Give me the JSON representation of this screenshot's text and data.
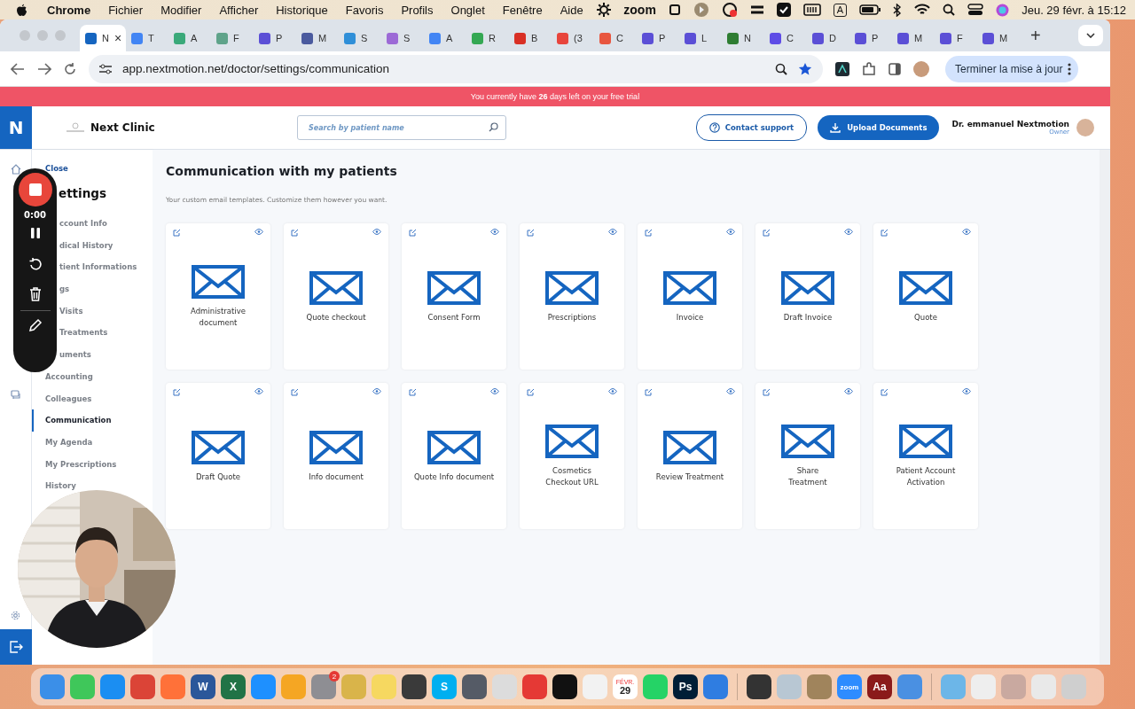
{
  "menubar": {
    "app": "Chrome",
    "menus": [
      "Fichier",
      "Modifier",
      "Afficher",
      "Historique",
      "Favoris",
      "Profils",
      "Onglet",
      "Fenêtre",
      "Aide"
    ],
    "zoom_label": "zoom",
    "input_source": "A",
    "clock": "Jeu. 29 févr. à 15:12"
  },
  "tab_close": "×",
  "new_tab": "+",
  "tabs": [
    {
      "label": "N",
      "selected": true,
      "color": "#1565c0"
    },
    {
      "label": "T",
      "selected": false,
      "color": "#4285f4"
    },
    {
      "label": "A",
      "selected": false,
      "color": "#3aa97a"
    },
    {
      "label": "F",
      "selected": false,
      "color": "#5fa38a"
    },
    {
      "label": "P",
      "selected": false,
      "color": "#5b4fd6"
    },
    {
      "label": "M",
      "selected": false,
      "color": "#4a5a9e"
    },
    {
      "label": "S",
      "selected": false,
      "color": "#2f8fd8"
    },
    {
      "label": "S",
      "selected": false,
      "color": "#9c6ad6"
    },
    {
      "label": "A",
      "selected": false,
      "color": "#4285f4"
    },
    {
      "label": "R",
      "selected": false,
      "color": "#34a853"
    },
    {
      "label": "B",
      "selected": false,
      "color": "#d93025"
    },
    {
      "label": "(3",
      "selected": false,
      "color": "#e8453c"
    },
    {
      "label": "C",
      "selected": false,
      "color": "#e8563f"
    },
    {
      "label": "P",
      "selected": false,
      "color": "#5b4fd6"
    },
    {
      "label": "L",
      "selected": false,
      "color": "#5b4fd6"
    },
    {
      "label": "N",
      "selected": false,
      "color": "#2e7d32"
    },
    {
      "label": "C",
      "selected": false,
      "color": "#5e4ce6"
    },
    {
      "label": "D",
      "selected": false,
      "color": "#5b4fd6"
    },
    {
      "label": "P",
      "selected": false,
      "color": "#5b4fd6"
    },
    {
      "label": "M",
      "selected": false,
      "color": "#5b4fd6"
    },
    {
      "label": "F",
      "selected": false,
      "color": "#5b4fd6"
    },
    {
      "label": "M",
      "selected": false,
      "color": "#5b4fd6"
    }
  ],
  "toolbar": {
    "url": "app.nextmotion.net/doctor/settings/communication",
    "update_button": "Terminer la mise à jour"
  },
  "banner": {
    "text": "You currently have **26** days left on your free trial"
  },
  "header": {
    "logo": "N",
    "clinic": "Next Clinic",
    "search_placeholder": "Search by patient name",
    "contact": "Contact support",
    "upload": "Upload Documents",
    "user": "Dr. emmanuel Nextmotion",
    "role": "Owner"
  },
  "sidebar": {
    "close": "Close",
    "title": "ettings",
    "items": [
      {
        "label": "ccount Info",
        "selected": false
      },
      {
        "label": "dical History",
        "selected": false
      },
      {
        "label": "tient Informations",
        "selected": false
      },
      {
        "label": "gs",
        "selected": false
      },
      {
        "label": "Visits",
        "selected": false
      },
      {
        "label": "Treatments",
        "selected": false
      },
      {
        "label": "uments",
        "selected": false
      },
      {
        "label": "Accounting",
        "selected": false
      },
      {
        "label": "Colleagues",
        "selected": false
      },
      {
        "label": "Communication",
        "selected": true
      },
      {
        "label": "My Agenda",
        "selected": false
      },
      {
        "label": "My Prescriptions",
        "selected": false
      },
      {
        "label": "History",
        "selected": false
      }
    ]
  },
  "content": {
    "title": "Communication with my patients",
    "subtitle": "Your custom email templates. Customize them however you want.",
    "templates": [
      {
        "label": "Administrative\ndocument"
      },
      {
        "label": "Quote checkout"
      },
      {
        "label": "Consent Form"
      },
      {
        "label": "Prescriptions"
      },
      {
        "label": "Invoice"
      },
      {
        "label": "Draft Invoice"
      },
      {
        "label": "Quote"
      },
      {
        "label": "Draft Quote"
      },
      {
        "label": "Info document"
      },
      {
        "label": "Quote Info document"
      },
      {
        "label": "Cosmetics\nCheckout URL"
      },
      {
        "label": "Review Treatment"
      },
      {
        "label": "Share\nTreatment"
      },
      {
        "label": "Patient Account\nActivation"
      }
    ]
  },
  "recorder": {
    "time": "0:00"
  },
  "dock": [
    {
      "kind": "app",
      "color": "#3b8fe8"
    },
    {
      "kind": "app",
      "color": "#3fc75a"
    },
    {
      "kind": "app",
      "color": "#1b8ef2"
    },
    {
      "kind": "app",
      "color": "#db4437"
    },
    {
      "kind": "app",
      "color": "#ff7139"
    },
    {
      "kind": "app",
      "color": "#2b579a",
      "label": "W"
    },
    {
      "kind": "app",
      "color": "#217346",
      "label": "X"
    },
    {
      "kind": "app",
      "color": "#1e90ff"
    },
    {
      "kind": "app",
      "color": "#f5a623"
    },
    {
      "kind": "app",
      "color": "#8e8e93",
      "badge": "2"
    },
    {
      "kind": "app",
      "color": "#d9b44a"
    },
    {
      "kind": "app",
      "color": "#f6d860"
    },
    {
      "kind": "app",
      "color": "#3a3a3a"
    },
    {
      "kind": "app",
      "color": "#00aff0",
      "label": "S"
    },
    {
      "kind": "app",
      "color": "#555b66"
    },
    {
      "kind": "app",
      "color": "#dcdcdc"
    },
    {
      "kind": "app",
      "color": "#e53935"
    },
    {
      "kind": "app",
      "color": "#111111"
    },
    {
      "kind": "app",
      "color": "#f2f2f2"
    },
    {
      "kind": "calendar",
      "color": "#ffffff",
      "label": "29",
      "month": "FÉVR."
    },
    {
      "kind": "app",
      "color": "#25d366"
    },
    {
      "kind": "app",
      "color": "#001e36",
      "label": "Ps"
    },
    {
      "kind": "app",
      "color": "#2f7de1"
    },
    {
      "kind": "separator"
    },
    {
      "kind": "app",
      "color": "#333333"
    },
    {
      "kind": "app",
      "color": "#b8c7d3"
    },
    {
      "kind": "app",
      "color": "#a0845c"
    },
    {
      "kind": "app",
      "color": "#2d8cff",
      "label": "zoom"
    },
    {
      "kind": "app",
      "color": "#8b1a1a",
      "label": "Aa"
    },
    {
      "kind": "app",
      "color": "#4a90e2"
    },
    {
      "kind": "separator"
    },
    {
      "kind": "app",
      "color": "#6cb6e8"
    },
    {
      "kind": "app",
      "color": "#eeeeee"
    },
    {
      "kind": "app",
      "color": "#c9a9a0"
    },
    {
      "kind": "app",
      "color": "#e9e9e9"
    },
    {
      "kind": "app",
      "color": "#cfcfcf"
    }
  ]
}
